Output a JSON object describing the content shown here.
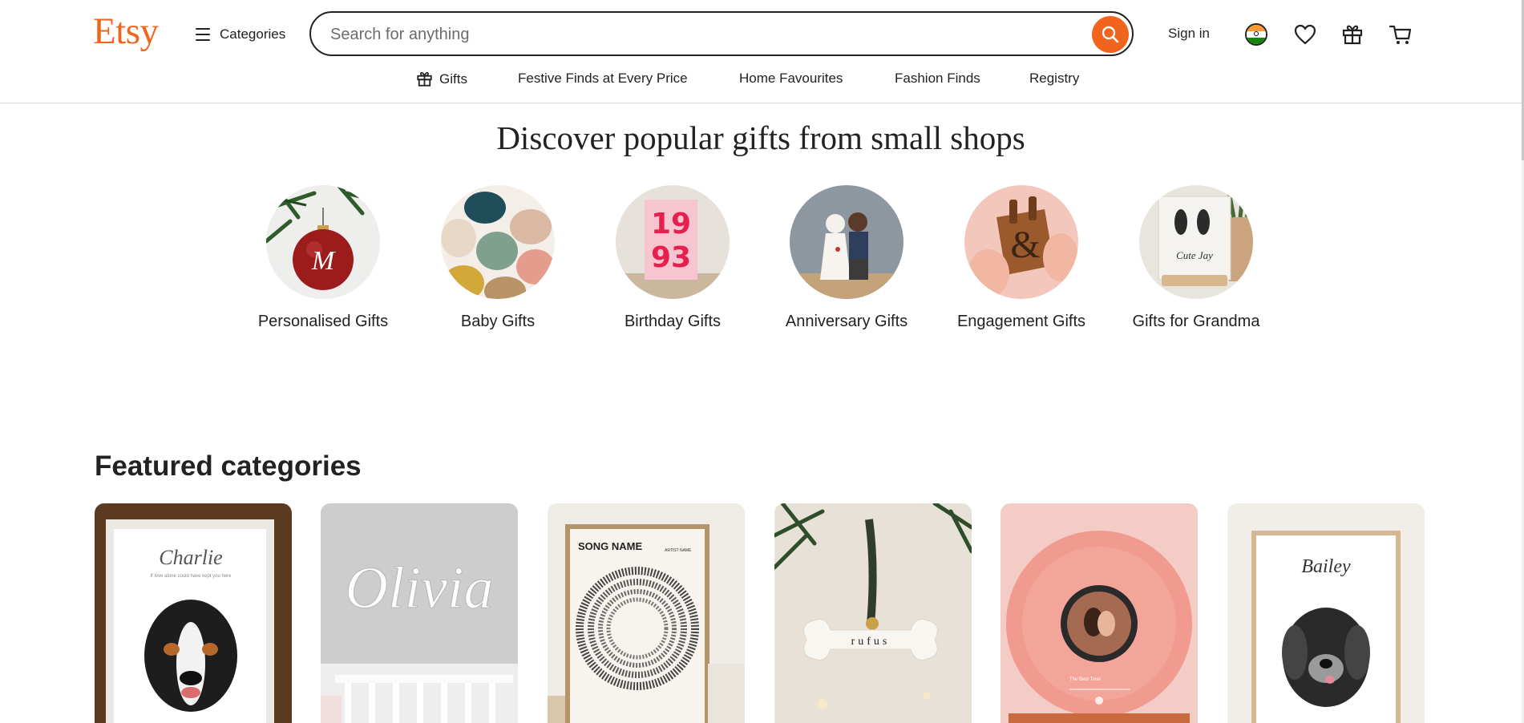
{
  "header": {
    "logo": "Etsy",
    "categories_label": "Categories",
    "search_placeholder": "Search for anything",
    "sign_in": "Sign in"
  },
  "subnav": {
    "items": [
      "Gifts",
      "Festive Finds at Every Price",
      "Home Favourites",
      "Fashion Finds",
      "Registry"
    ]
  },
  "discover": {
    "title": "Discover popular gifts from small shops",
    "items": [
      {
        "label": "Personalised Gifts"
      },
      {
        "label": "Baby Gifts"
      },
      {
        "label": "Birthday Gifts"
      },
      {
        "label": "Anniversary Gifts"
      },
      {
        "label": "Engagement Gifts"
      },
      {
        "label": "Gifts for Grandma"
      }
    ],
    "ornament_text": "M",
    "poster_text": [
      "19",
      "93"
    ],
    "frame_text": "Cute Jay"
  },
  "featured": {
    "title": "Featured categories",
    "cards": [
      {
        "name": "Charlie",
        "caption": "If love alone could have kept you here"
      },
      {
        "name": "Olivia"
      },
      {
        "name": "SONG NAME",
        "artist": "ARTIST NAME"
      },
      {
        "name": "rufus"
      },
      {
        "name": "The Best Time"
      },
      {
        "name": "Bailey"
      }
    ]
  },
  "colors": {
    "brand": "#f1641e",
    "text": "#222222",
    "border": "#d8d8d8"
  },
  "icons": [
    "hamburger-icon",
    "search-icon",
    "india-flag-icon",
    "heart-icon",
    "gift-icon",
    "cart-icon"
  ]
}
